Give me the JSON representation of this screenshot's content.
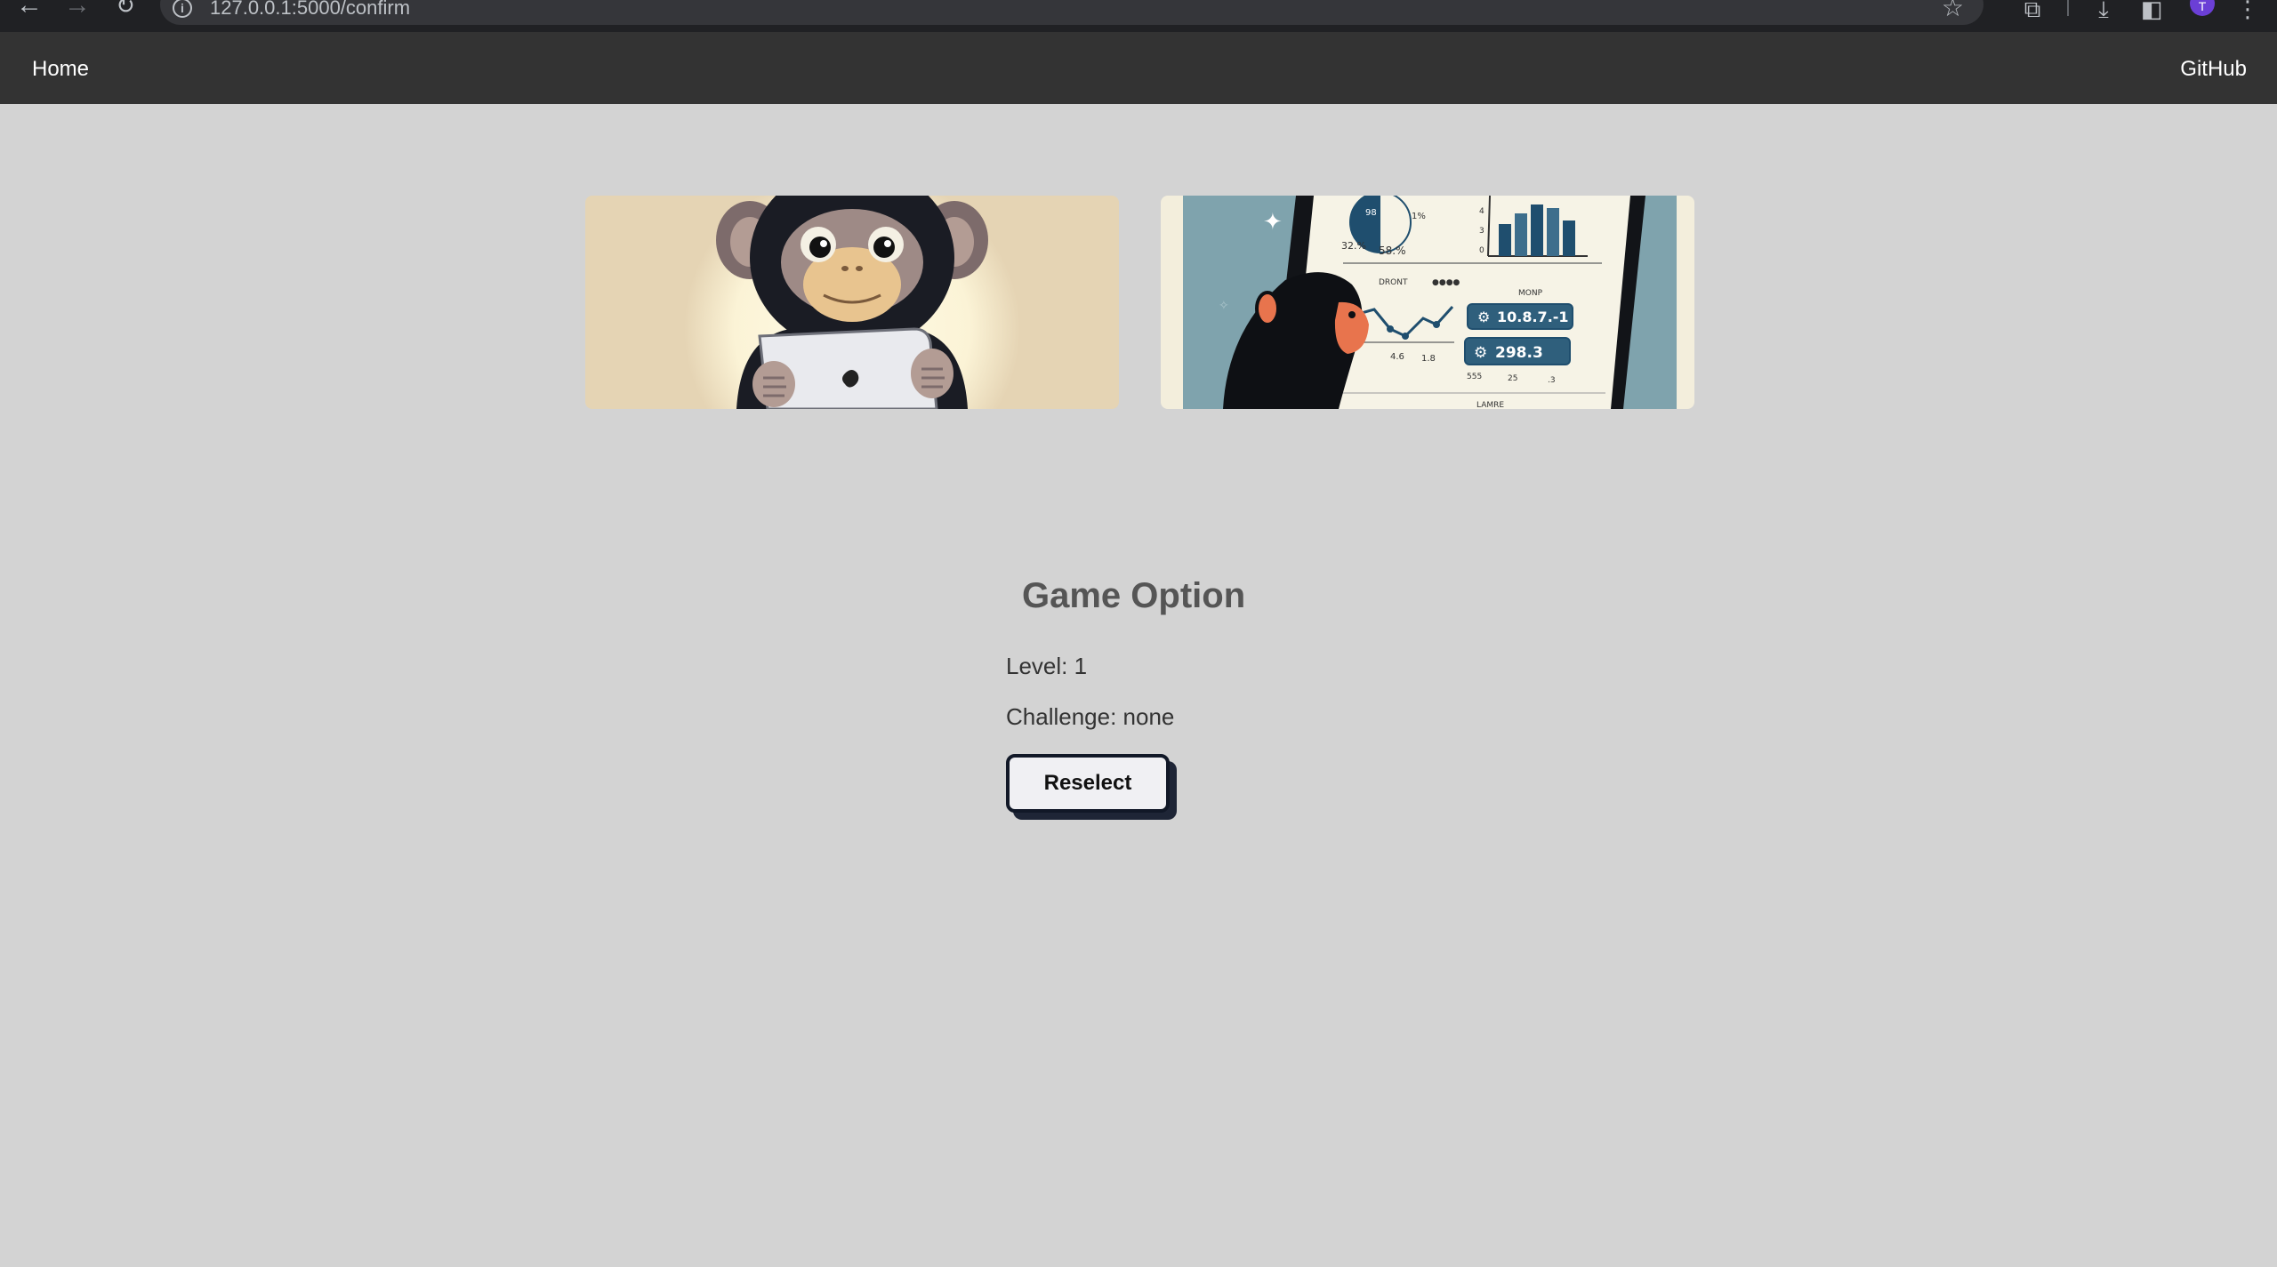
{
  "browser": {
    "url": "127.0.0.1:5000/confirm",
    "profile_initial": "T",
    "profile_color": "#6b3fd6"
  },
  "navbar": {
    "home_label": "Home",
    "github_label": "GitHub"
  },
  "images": [
    {
      "name": "chimp-with-tablet-illustration"
    },
    {
      "name": "chimp-viewing-dashboard-illustration",
      "dashboard_text": [
        "98",
        "1%",
        "32.%",
        "58.%",
        "DRONT",
        "MONP",
        "10.8.7.-1",
        "298.3",
        "4.6",
        "1.8",
        "555",
        "25",
        ".3",
        "LAMRE"
      ]
    }
  ],
  "game_option": {
    "title": "Game Option",
    "level": "Level: 1",
    "challenge": "Challenge: none",
    "reselect_label": "Reselect"
  },
  "colors": {
    "page_bg": "#d3d3d3",
    "navbar_bg": "#333333",
    "button_shadow": "#1e2536"
  }
}
